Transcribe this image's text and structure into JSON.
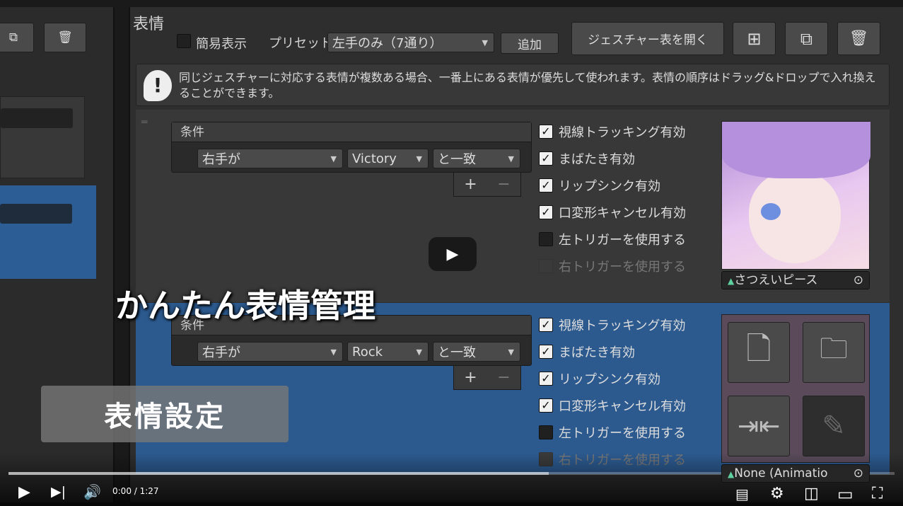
{
  "panel": {
    "title": "表情",
    "simple_view_label": "簡易表示",
    "preset_label": "プリセット",
    "preset_value": "左手のみ（7通り）",
    "add_label": "追加",
    "open_gesture_table": "ジェスチャー表を開く"
  },
  "info": {
    "text": "同じジェスチャーに対応する表情が複数ある場合、一番上にある表情が優先して使われます。表情の順序はドラッグ&ドロップで入れ換えることができます。"
  },
  "rows": [
    {
      "condition_header": "条件",
      "hand": "右手が",
      "gesture": "Victory",
      "match": "と一致",
      "options": [
        {
          "label": "視線トラッキング有効",
          "checked": true
        },
        {
          "label": "まばたき有効",
          "checked": true
        },
        {
          "label": "リップシンク有効",
          "checked": true
        },
        {
          "label": "口変形キャンセル有効",
          "checked": true
        },
        {
          "label": "左トリガーを使用する",
          "checked": false
        },
        {
          "label": "右トリガーを使用する",
          "checked": false,
          "disabled": true
        }
      ],
      "animation": "さつえいピース"
    },
    {
      "condition_header": "条件",
      "hand": "右手が",
      "gesture": "Rock",
      "match": "と一致",
      "options": [
        {
          "label": "視線トラッキング有効",
          "checked": true
        },
        {
          "label": "まばたき有効",
          "checked": true
        },
        {
          "label": "リップシンク有効",
          "checked": true
        },
        {
          "label": "口変形キャンセル有効",
          "checked": true
        },
        {
          "label": "左トリガーを使用する",
          "checked": false
        },
        {
          "label": "右トリガーを使用する",
          "checked": false,
          "disabled": true
        }
      ],
      "animation": "None (Animatio"
    }
  ],
  "overlay": {
    "caption": "かんたん表情管理",
    "chapter": "表情設定"
  },
  "player": {
    "time": "0:00 / 1:27",
    "played": 0,
    "buffered": 0.61,
    "accent": "#ff0000"
  }
}
